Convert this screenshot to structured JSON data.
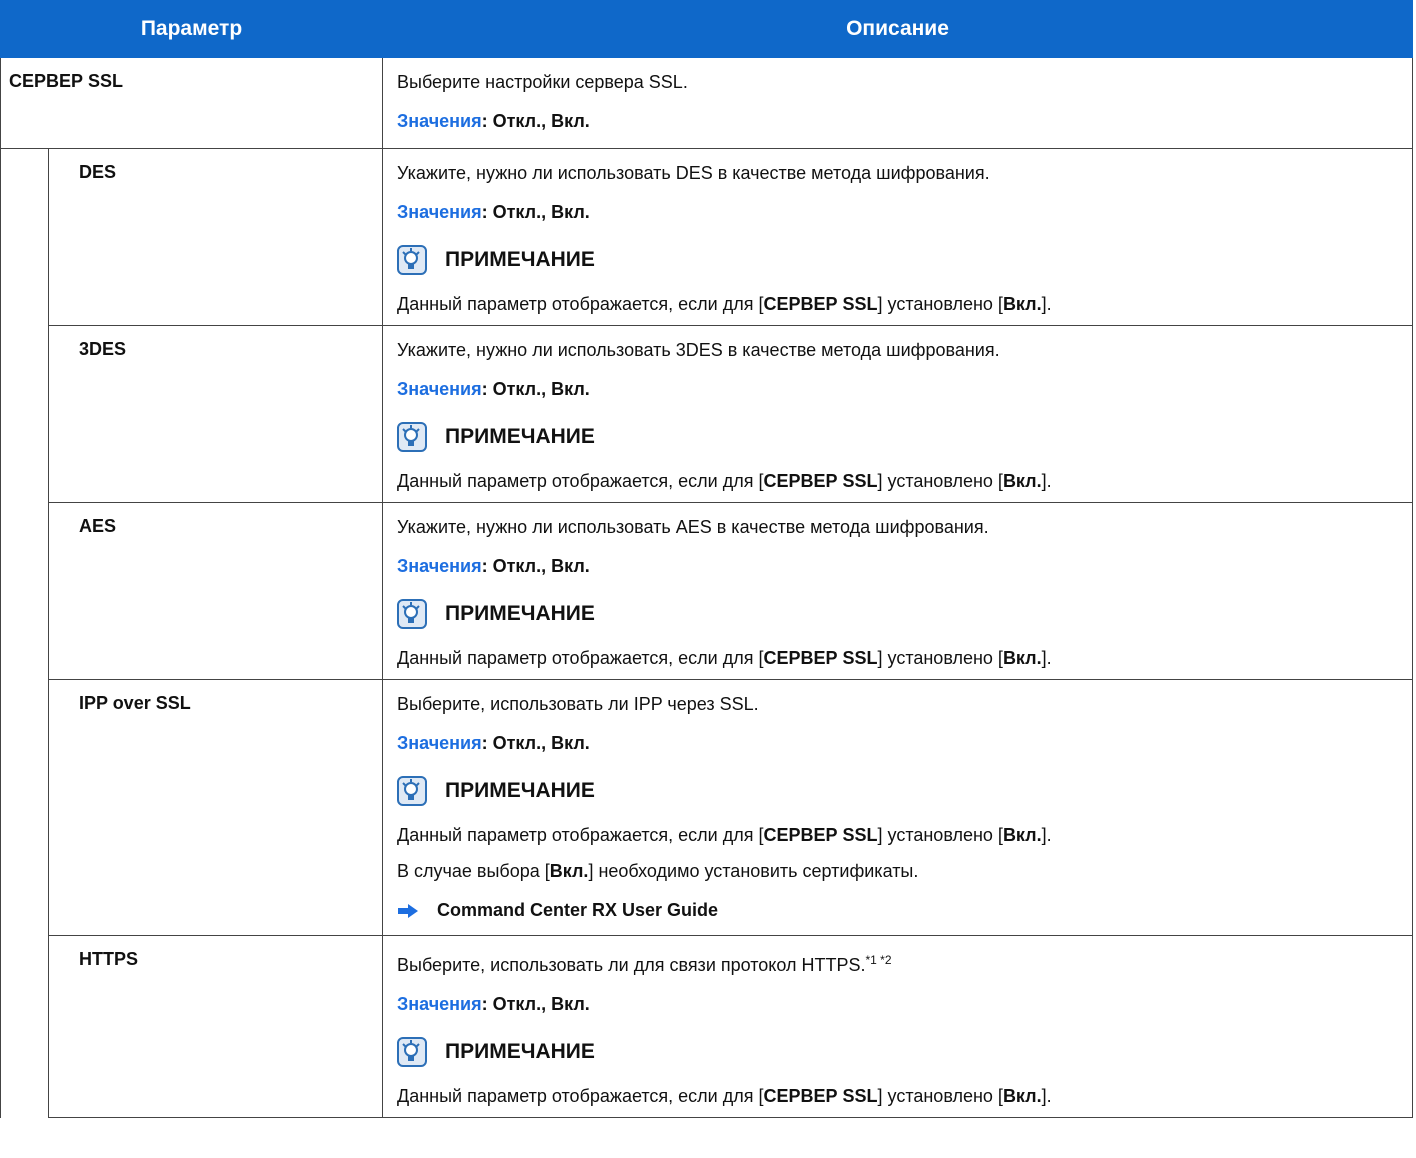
{
  "header": {
    "param": "Параметр",
    "desc": "Описание"
  },
  "values_label": "Значения",
  "values_text": ": Откл., Вкл.",
  "note_title": "ПРИМЕЧАНИЕ",
  "rows": [
    {
      "param": "СЕРВЕР SSL",
      "desc": "Выберите настройки сервера SSL.",
      "values": "Значения: Откл., Вкл."
    },
    {
      "param": "DES",
      "desc": "Укажите, нужно ли использовать DES в качестве метода шифрования.",
      "note": "Данный параметр отображается, если для [СЕРВЕР SSL] установлено [Вкл.]."
    },
    {
      "param": "3DES",
      "desc": "Укажите, нужно ли использовать 3DES в качестве метода шифрования.",
      "note": "Данный параметр отображается, если для [СЕРВЕР SSL] установлено [Вкл.]."
    },
    {
      "param": "AES",
      "desc": "Укажите, нужно ли использовать AES в качестве метода шифрования.",
      "note": "Данный параметр отображается, если для [СЕРВЕР SSL] установлено [Вкл.]."
    },
    {
      "param": "IPP over SSL",
      "desc": "Выберите, использовать ли IPP через SSL.",
      "note": "Данный параметр отображается, если для [СЕРВЕР SSL] установлено [Вкл.].",
      "note2": "В случае выбора [Вкл.] необходимо установить сертификаты.",
      "link": "Command Center RX User Guide"
    },
    {
      "param": "HTTPS",
      "desc": "Выберите, использовать ли для связи протокол HTTPS.",
      "sup": "*1 *2",
      "note": "Данный параметр отображается, если для [СЕРВЕР SSL] установлено [Вкл.]."
    }
  ],
  "note_parts": {
    "pre": "Данный параметр отображается, если для [",
    "b1": "СЕРВЕР SSL",
    "mid": "] установлено [",
    "b2": "Вкл.",
    "post": "]."
  },
  "note2_parts": {
    "pre": "В случае выбора [",
    "b": "Вкл.",
    "post": "] необходимо установить сертификаты."
  },
  "colors": {
    "header_bg": "#0f68c9",
    "values_blue": "#1d6ee0"
  },
  "icons": {
    "note": "lightbulb-note-icon",
    "link": "arrow-right-icon"
  }
}
